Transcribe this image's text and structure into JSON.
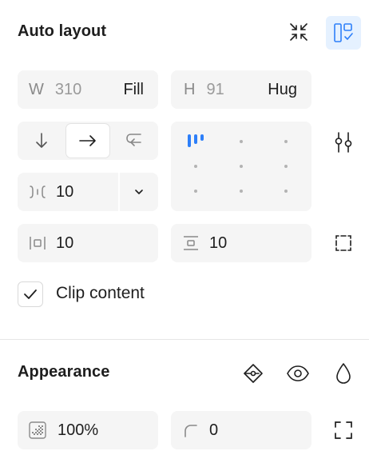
{
  "auto_layout": {
    "title": "Auto layout",
    "width": {
      "label": "W",
      "value": "310",
      "mode": "Fill"
    },
    "height": {
      "label": "H",
      "value": "91",
      "mode": "Hug"
    },
    "direction": {
      "options": [
        "vertical",
        "horizontal",
        "wrap"
      ],
      "selected": "horizontal"
    },
    "alignment_selected": "top-left",
    "gap": {
      "value": "10"
    },
    "padding_horizontal": {
      "value": "10"
    },
    "padding_vertical": {
      "value": "10"
    },
    "clip_content": {
      "label": "Clip content",
      "checked": true
    }
  },
  "appearance": {
    "title": "Appearance",
    "opacity": {
      "value": "100%"
    },
    "corner_radius": {
      "value": "0"
    }
  },
  "colors": {
    "accent": "#2d7ff9",
    "accent_bg": "#e5f1ff",
    "field_bg": "#f5f5f5"
  },
  "icons": {
    "collapse": "collapse-arrows-icon",
    "layout_toggle": "auto-layout-icon",
    "settings": "sliders-icon",
    "independent_padding": "padding-corners-icon",
    "style": "style-diamond-icon",
    "visibility": "eye-icon",
    "blend": "drop-icon",
    "expand_corners": "expand-corners-icon"
  }
}
